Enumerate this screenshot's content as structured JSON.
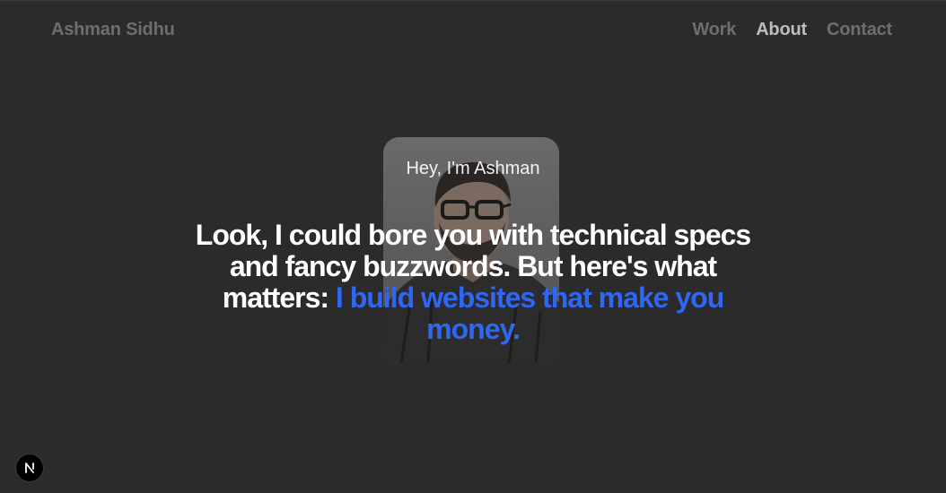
{
  "header": {
    "brand": "Ashman Sidhu",
    "nav": [
      {
        "label": "Work",
        "active": false
      },
      {
        "label": "About",
        "active": true
      },
      {
        "label": "Contact",
        "active": false
      }
    ]
  },
  "hero": {
    "greeting": "Hey, I'm Ashman",
    "headline_plain": "Look, I could bore you with technical specs and fancy buzzwords. But here's what matters:",
    "headline_highlight": "I build websites that make you money.",
    "portrait_icon": "person-photo"
  },
  "footer": {
    "dev_badge_icon": "nextjs-icon"
  },
  "colors": {
    "background": "#2b2b2b",
    "highlight": "#2f66f2",
    "nav_muted": "#6e6e6e",
    "nav_active": "#bdbdbd"
  }
}
